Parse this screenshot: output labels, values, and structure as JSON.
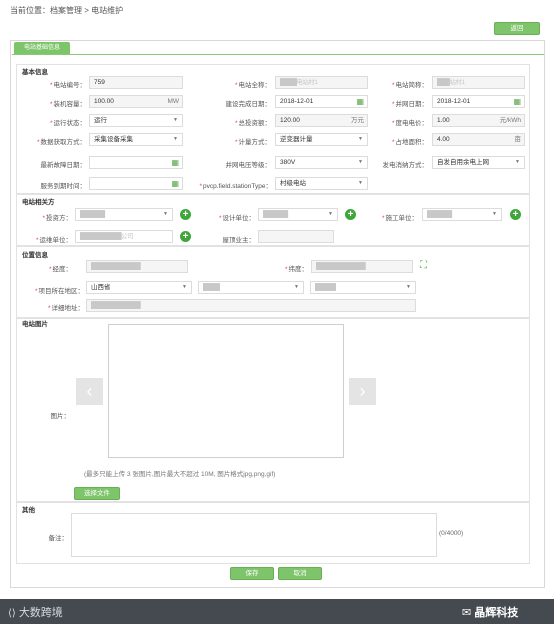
{
  "breadcrumb": "当前位置：档案管理 > 电站维护",
  "buttons": {
    "back": "返回",
    "save": "保存",
    "cancel": "取消",
    "choose_file": "选择文件"
  },
  "tab": "电站基础信息",
  "basic": {
    "title": "基本信息",
    "station_no_label": "电站编号：",
    "station_no": "759",
    "station_fullname_label": "电站全称：",
    "station_fullname": "████电站村1",
    "station_short_label": "电站简称：",
    "station_short": "███站村1",
    "capacity_label": "装机容量：",
    "capacity": "100.00",
    "capacity_unit": "MW",
    "build_date_label": "建设完成日期：",
    "build_date": "2018-12-01",
    "grid_date_label": "并网日期：",
    "grid_date": "2018-12-01",
    "run_state_label": "运行状态：",
    "run_state": "运行",
    "total_invest_label": "总投资额：",
    "total_invest": "120.00",
    "total_invest_unit": "万元",
    "price_label": "度电电价：",
    "price": "1.00",
    "price_unit": "元/kWh",
    "data_mode_label": "数据获取方式：",
    "data_mode": "采集设备采集",
    "metering_label": "计量方式：",
    "metering": "逆变器计量",
    "area_label": "占地面积：",
    "area": "4.00",
    "area_unit": "亩",
    "last_fault_label": "最新故障日期：",
    "voltage_label": "并网电压等级：",
    "voltage": "380V",
    "consume_label": "发电消纳方式：",
    "consume": "自发自用余电上网",
    "service_end_label": "服务到期时间：",
    "pvcp_label": "pvcp.field.stationType：",
    "pvcp": "村级电站"
  },
  "related": {
    "title": "电站相关方",
    "investor_label": "投资方：",
    "investor": "██████",
    "designer_label": "设计单位：",
    "designer": "██████",
    "builder_label": "施工单位：",
    "builder": "██████",
    "operator_label": "运维单位：",
    "operator": "██████████公司",
    "roof_owner_label": "屋顶业主："
  },
  "location": {
    "title": "位置信息",
    "lng_label": "经度：",
    "lng": "████████████",
    "lat_label": "纬度：",
    "lat": "████████████",
    "region_label": "项目所在地区：",
    "province": "山西省",
    "city": "████",
    "county": "█████",
    "address_label": "详细地址：",
    "address": "████████████"
  },
  "pictures": {
    "title": "电站图片",
    "image_label": "图片：",
    "hint": "(最多只能上传 3 张图片,图片最大不超过 10M, 图片格式jpg,png,gif)"
  },
  "other": {
    "title": "其他",
    "remark_label": "备注：",
    "counter": "(0/4000)"
  },
  "watermark": {
    "left": "大数跨境",
    "right": "晶辉科技"
  }
}
